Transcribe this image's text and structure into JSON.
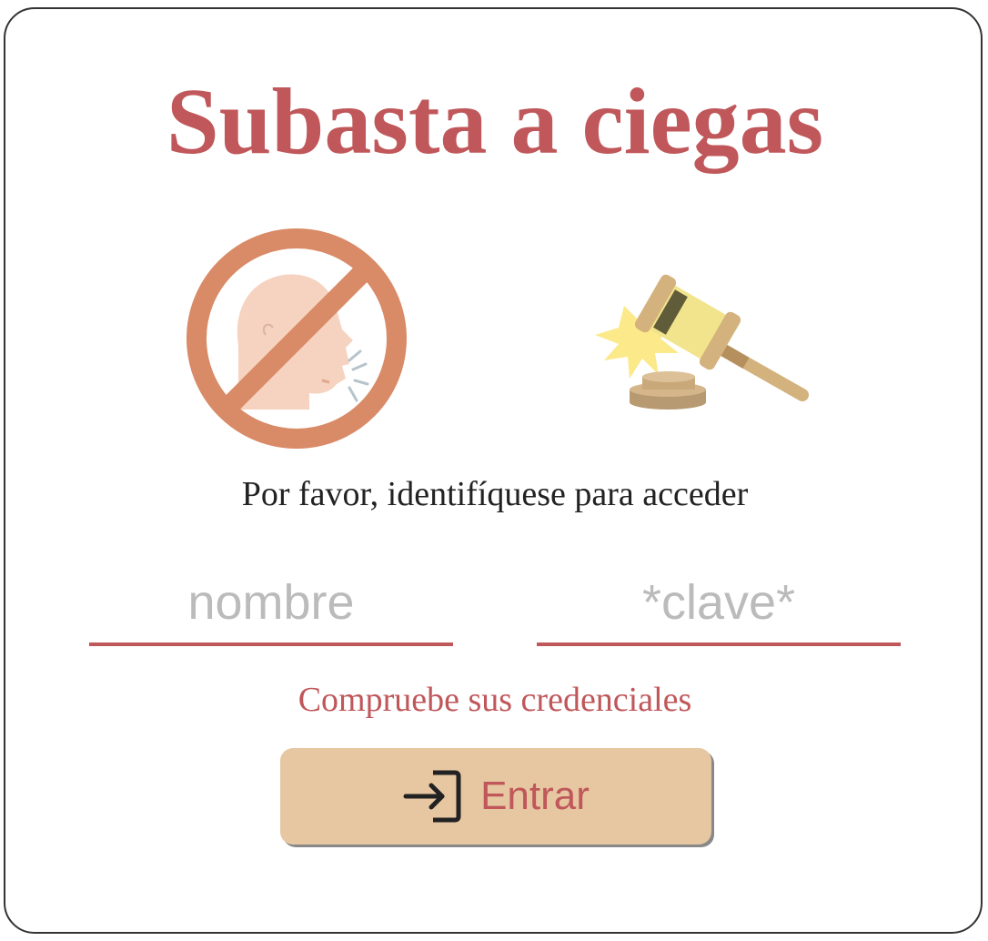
{
  "title": "Subasta a ciegas",
  "prompt": "Por favor, identifíquese para acceder",
  "form": {
    "name_placeholder": "nombre",
    "name_value": "",
    "password_placeholder": "*clave*",
    "password_value": ""
  },
  "error_message": "Compruebe sus credenciales",
  "enter_button": {
    "label": "Entrar",
    "icon": "login-icon"
  },
  "icons": {
    "no_speaking": "no-speaking-icon",
    "gavel": "gavel-icon"
  },
  "colors": {
    "accent": "#c0575a",
    "button_bg": "#e6c7a1",
    "placeholder": "#bbbbbb",
    "prohibition": "#d98a66",
    "face": "#f6d3c0"
  }
}
